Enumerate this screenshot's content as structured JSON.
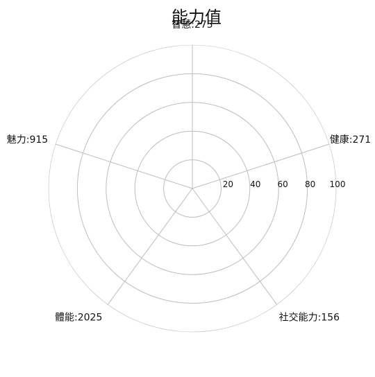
{
  "chart_data": {
    "type": "radar",
    "title": "能力值",
    "axes": [
      {
        "name": "智慧",
        "value": 275,
        "label": "智慧:275"
      },
      {
        "name": "健康",
        "value": 271,
        "label": "健康:271"
      },
      {
        "name": "社交能力",
        "value": 156,
        "label": "社交能力:156"
      },
      {
        "name": "體能",
        "value": 2025,
        "label": "體能:2025"
      },
      {
        "name": "魅力",
        "value": 915,
        "label": "魅力:915"
      }
    ],
    "radial_ticks": [
      "20",
      "40",
      "60",
      "80",
      "100"
    ],
    "rlim": [
      0,
      100
    ],
    "grid": true,
    "colors": {
      "grid": "#bdbdbd",
      "text": "#111111"
    }
  }
}
